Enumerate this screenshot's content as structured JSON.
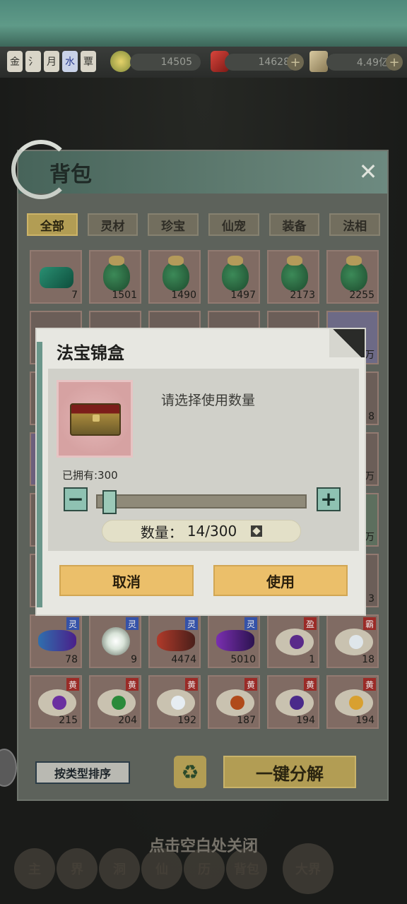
{
  "top_bar": {
    "badges": [
      "金",
      "氵",
      "月",
      "水",
      "覃"
    ],
    "resources": [
      {
        "name": "spirit",
        "value": "14505"
      },
      {
        "name": "jade",
        "value": "14628"
      },
      {
        "name": "coin",
        "value": "4.49亿"
      }
    ]
  },
  "bag": {
    "title": "背包",
    "tabs": [
      "全部",
      "灵材",
      "珍宝",
      "仙宠",
      "装备",
      "法相"
    ],
    "active_tab": "全部",
    "rows": [
      {
        "counts": [
          "7",
          "1501",
          "1490",
          "1497",
          "2173",
          "2255"
        ]
      },
      {
        "counts": [
          "",
          "",
          "",
          "",
          "",
          "万"
        ]
      },
      {
        "counts": [
          "",
          "",
          "",
          "",
          "",
          "8"
        ]
      },
      {
        "counts": [
          "",
          "",
          "",
          "",
          "",
          "万"
        ]
      },
      {
        "counts": [
          "",
          "",
          "",
          "",
          "",
          "万"
        ]
      },
      {
        "counts": [
          "",
          "",
          "",
          "",
          "",
          "3"
        ]
      },
      {
        "counts": [
          "78",
          "9",
          "4474",
          "5010",
          "1",
          "18"
        ],
        "tags": [
          "灵",
          "灵",
          "灵",
          "灵",
          "盈",
          "霸"
        ]
      },
      {
        "counts": [
          "215",
          "204",
          "192",
          "187",
          "194",
          "194"
        ],
        "tags": [
          "黄",
          "黄",
          "黄",
          "黄",
          "黄",
          "黄"
        ]
      }
    ],
    "sort_label": "按类型排序",
    "decompose_label": "一键分解"
  },
  "dialog": {
    "title": "法宝锦盒",
    "prompt": "请选择使用数量",
    "owned_label": "已拥有:300",
    "quantity_label": "数量：",
    "quantity_value": "14/300",
    "quantity_fraction": 0.047,
    "cancel_label": "取消",
    "use_label": "使用"
  },
  "hint": "点击空白处关闭",
  "bottom_nav": [
    "主",
    "界",
    "洞",
    "仙",
    "历",
    "背包",
    "大界"
  ]
}
